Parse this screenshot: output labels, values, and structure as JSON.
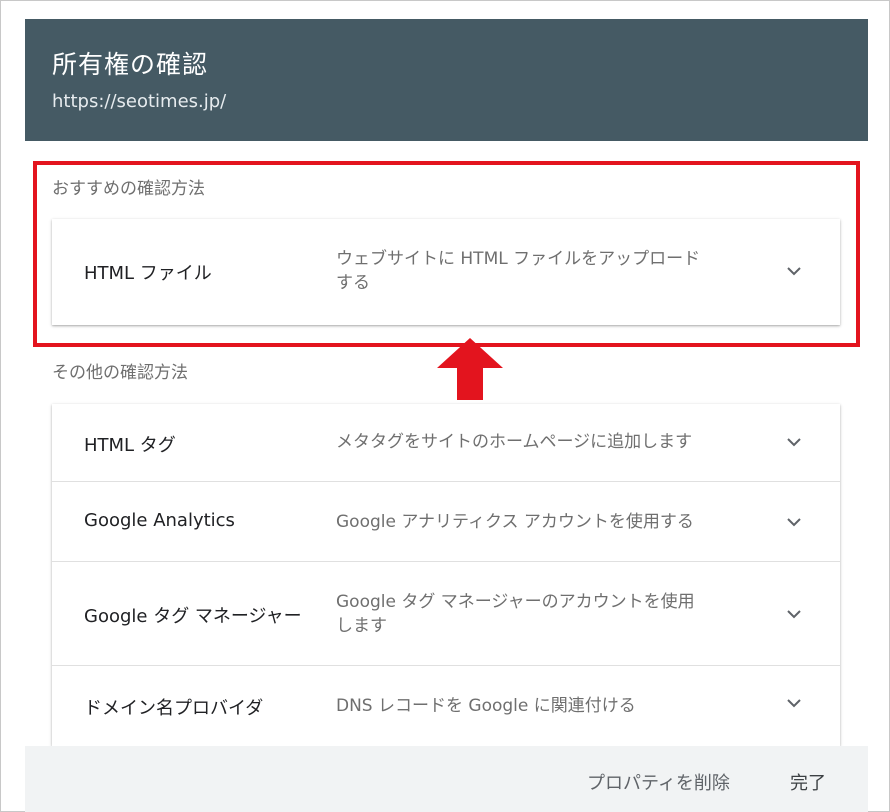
{
  "dialog": {
    "title": "所有権の確認",
    "subtitle": "https://seotimes.jp/"
  },
  "recommended": {
    "label": "おすすめの確認方法",
    "method": {
      "name": "HTML ファイル",
      "desc_line1": "ウェブサイトに HTML ファイルをアップロード",
      "desc_line2": "する"
    }
  },
  "other": {
    "label": "その他の確認方法",
    "methods": [
      {
        "name": "HTML タグ",
        "desc_line1": "メタタグをサイトのホームページに追加します",
        "desc_line2": ""
      },
      {
        "name": "Google Analytics",
        "desc_line1": "Google アナリティクス アカウントを使用する",
        "desc_line2": ""
      },
      {
        "name": "Google タグ マネージャー",
        "desc_line1": "Google タグ マネージャーのアカウントを使用",
        "desc_line2": "します"
      },
      {
        "name": "ドメイン名プロバイダ",
        "desc_line1": "DNS レコードを Google に関連付ける",
        "desc_line2": ""
      }
    ]
  },
  "footer": {
    "delete_label": "プロパティを削除",
    "done_label": "完了"
  },
  "colors": {
    "header_bg": "#455a64",
    "highlight": "#e3141e",
    "arrow": "#e3141e",
    "footer_bg": "#f1f3f4"
  },
  "icons": {
    "expand": "chevron-down-icon",
    "annotation": "red-up-arrow-icon"
  }
}
